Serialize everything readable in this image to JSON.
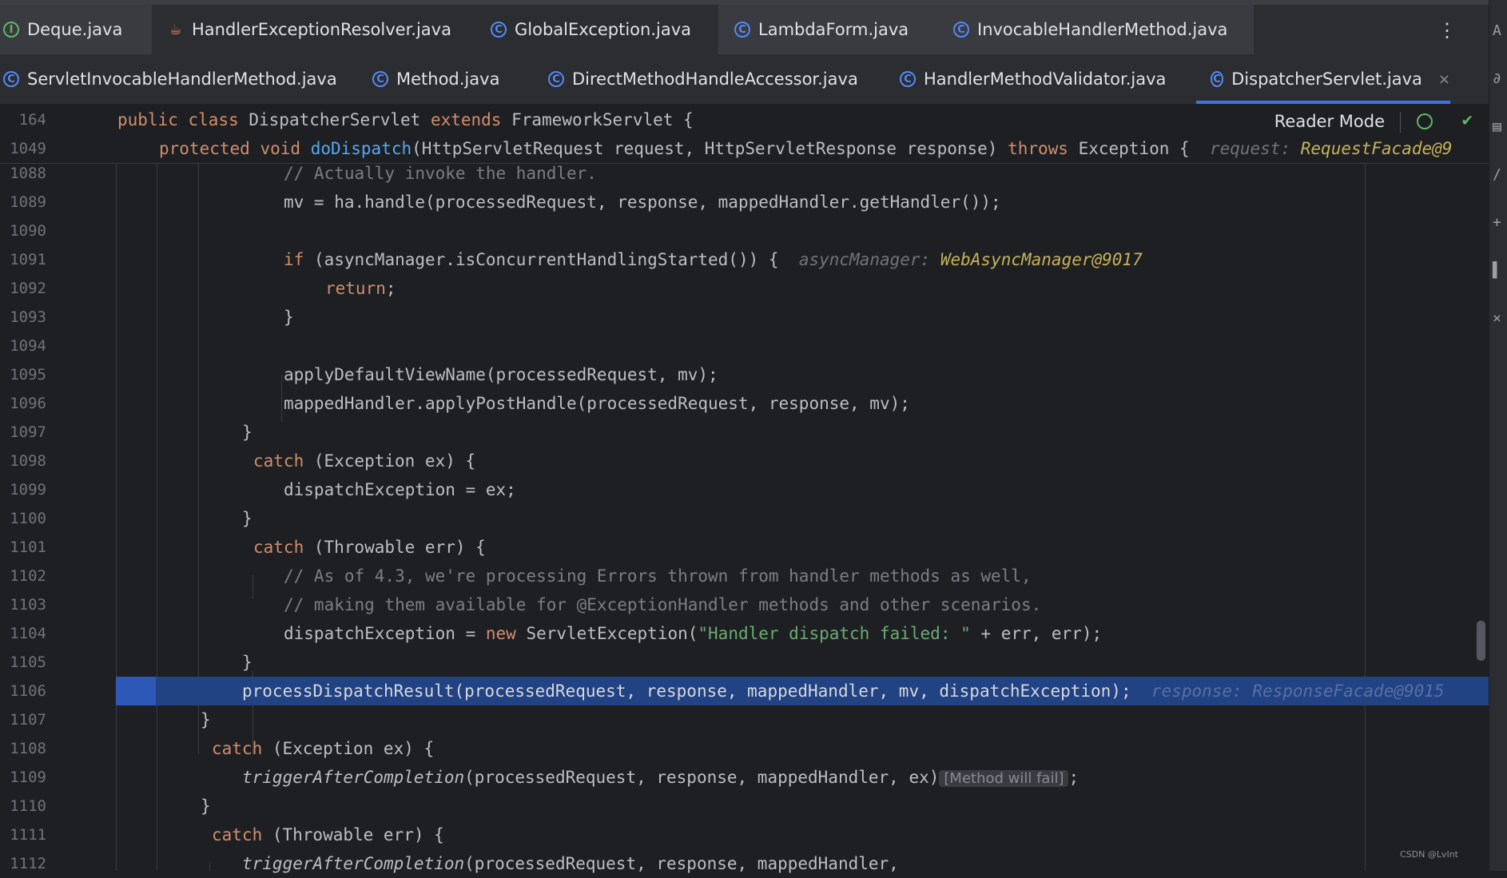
{
  "tabs_row1": [
    {
      "label": "Deque.java",
      "icon": "interface-icon"
    },
    {
      "label": "HandlerExceptionResolver.java",
      "icon": "java-cup-icon"
    },
    {
      "label": "GlobalException.java",
      "icon": "class-icon"
    },
    {
      "label": "LambdaForm.java",
      "icon": "class-icon"
    },
    {
      "label": "InvocableHandlerMethod.java",
      "icon": "class-icon"
    }
  ],
  "tabs_row2": [
    {
      "label": "ServletInvocableHandlerMethod.java",
      "icon": "class-icon"
    },
    {
      "label": "Method.java",
      "icon": "class-icon"
    },
    {
      "label": "DirectMethodHandleAccessor.java",
      "icon": "class-icon"
    },
    {
      "label": "HandlerMethodValidator.java",
      "icon": "class-icon"
    },
    {
      "label": "DispatcherServlet.java",
      "icon": "class-icon",
      "active": true
    }
  ],
  "more_glyph": "⋮",
  "close_glyph": "×",
  "reader_mode": "Reader Mode",
  "watermark": "CSDN @LvInt",
  "sticky": {
    "l164": {
      "num": "164",
      "t1": "public",
      "t2": " ",
      "t3": "class",
      "t4": " DispatcherServlet ",
      "t5": "extends",
      "t6": " FrameworkServlet {"
    },
    "l1049": {
      "num": "1049",
      "t1": "protected",
      "t2": " ",
      "t3": "void",
      "t4": "doDispatch",
      "t5": "(HttpServletRequest request, HttpServletResponse response) ",
      "t6": "throws",
      "t7": " Exception {",
      "hint": "request:",
      "hintv": "RequestFacade@9"
    }
  },
  "lines": {
    "l1088": {
      "num": "1088",
      "c": "// Actually invoke the handler."
    },
    "l1089": {
      "num": "1089",
      "c": "mv = ha.handle(processedRequest, response, mappedHandler.getHandler());"
    },
    "l1090": {
      "num": "1090"
    },
    "l1091": {
      "num": "1091",
      "kw": "if",
      "c": " (asyncManager.isConcurrentHandlingStarted()) {",
      "hint": "asyncManager:",
      "hintv": "WebAsyncManager@9017"
    },
    "l1092": {
      "num": "1092",
      "kw": "return",
      "c": ";"
    },
    "l1093": {
      "num": "1093",
      "c": "}"
    },
    "l1094": {
      "num": "1094"
    },
    "l1095": {
      "num": "1095",
      "c": "applyDefaultViewName(processedRequest, mv);"
    },
    "l1096": {
      "num": "1096",
      "c": "mappedHandler.applyPostHandle(processedRequest, response, mv);"
    },
    "l1097": {
      "num": "1097",
      "c": "}"
    },
    "l1098": {
      "num": "1098",
      "kw": "catch",
      "c": " (Exception ex) {"
    },
    "l1099": {
      "num": "1099",
      "c": "dispatchException = ex;"
    },
    "l1100": {
      "num": "1100",
      "c": "}"
    },
    "l1101": {
      "num": "1101",
      "kw": "catch",
      "c": " (Throwable err) {"
    },
    "l1102": {
      "num": "1102",
      "c": "// As of 4.3, we're processing Errors thrown from handler methods as well,"
    },
    "l1103": {
      "num": "1103",
      "c": "// making them available for @ExceptionHandler methods and other scenarios."
    },
    "l1104": {
      "num": "1104",
      "c1": "dispatchException = ",
      "kw": "new",
      "c2": " ServletException(",
      "str": "\"Handler dispatch failed: \"",
      "c3": " + err, err);"
    },
    "l1105": {
      "num": "1105",
      "c": "}"
    },
    "l1106": {
      "num": "1106",
      "c": "processDispatchResult(processedRequest, response, mappedHandler, mv, dispatchException);",
      "hint": "response:",
      "hintv": "ResponseFacade@9015"
    },
    "l1107": {
      "num": "1107",
      "c": "}"
    },
    "l1108": {
      "num": "1108",
      "kw": "catch",
      "c": " (Exception ex) {"
    },
    "l1109": {
      "num": "1109",
      "c1": "triggerAfterCompletion",
      "c2": "(processedRequest, response, mappedHandler, ex)",
      "badge": "[Method will fail]",
      "c3": ";"
    },
    "l1110": {
      "num": "1110",
      "c": "}"
    },
    "l1111": {
      "num": "1111",
      "kw": "catch",
      "c": " (Throwable err) {"
    },
    "l1112": {
      "num": "1112",
      "c1": "triggerAfterCompletion",
      "c2": "(processedRequest, response, mappedHandler,"
    }
  }
}
